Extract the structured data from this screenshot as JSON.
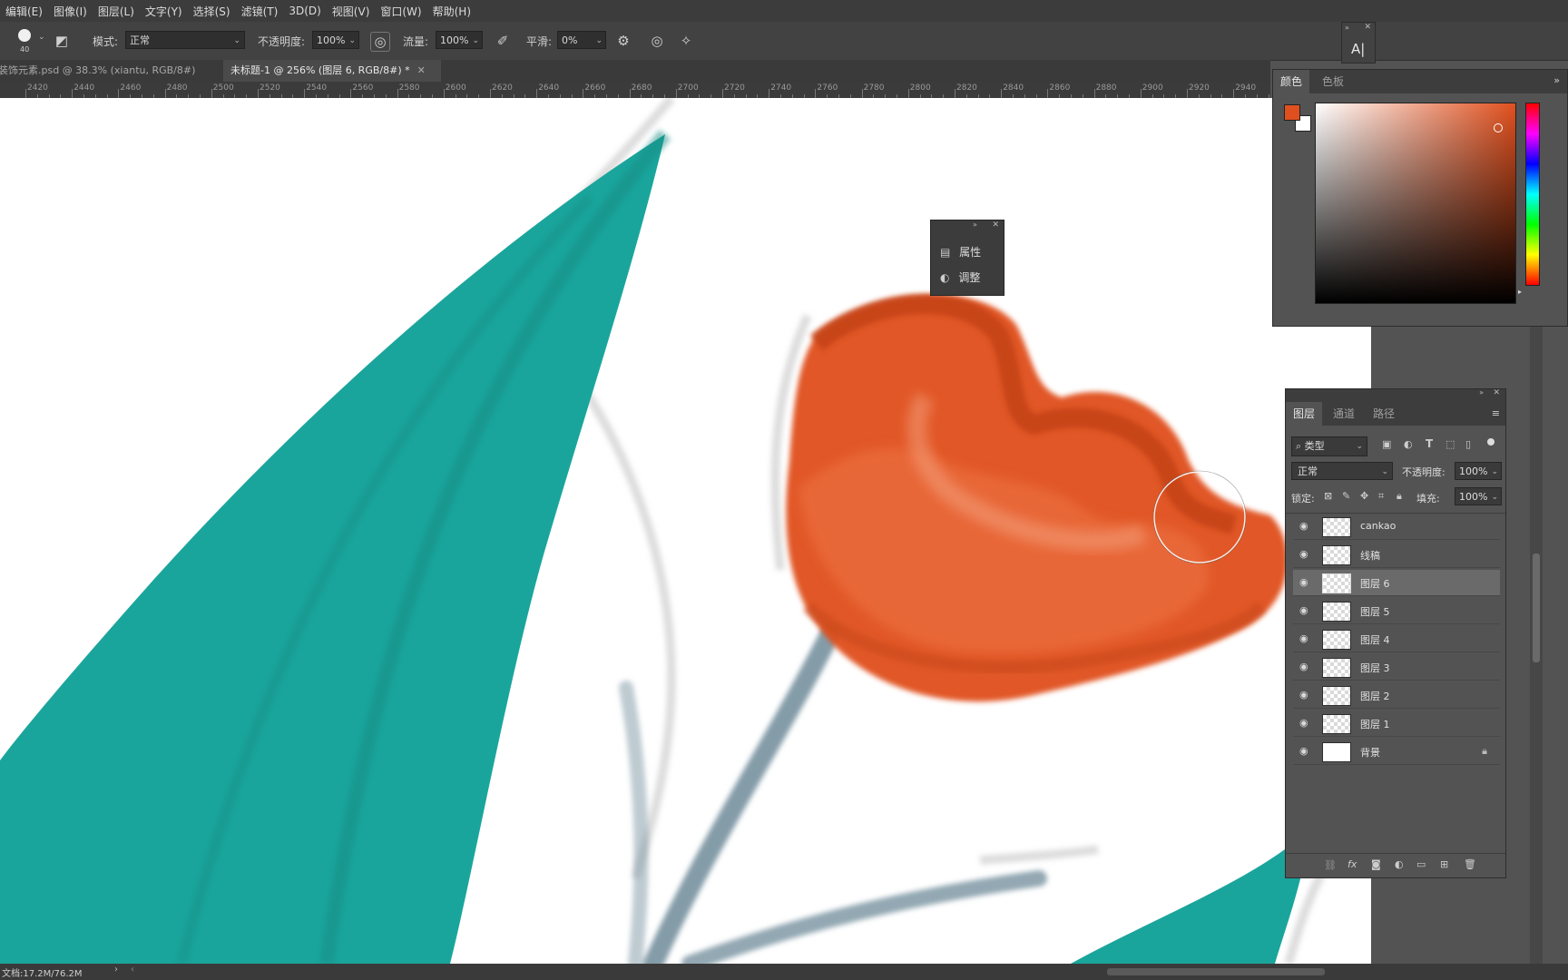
{
  "menu": [
    "编辑(E)",
    "图像(I)",
    "图层(L)",
    "文字(Y)",
    "选择(S)",
    "滤镜(T)",
    "3D(D)",
    "视图(V)",
    "窗口(W)",
    "帮助(H)"
  ],
  "options": {
    "brush_size": "40",
    "mode_label": "模式:",
    "mode_value": "正常",
    "opacity_label": "不透明度:",
    "opacity_value": "100%",
    "flow_label": "流量:",
    "flow_value": "100%",
    "smooth_label": "平滑:",
    "smooth_value": "0%"
  },
  "tabs": [
    {
      "label": "装饰元素.psd @ 38.3% (xiantu, RGB/8#) *",
      "active": false
    },
    {
      "label": "未标题-1 @ 256% (图层 6, RGB/8#) *",
      "active": true
    }
  ],
  "ruler_ticks": [
    "2420",
    "2440",
    "2460",
    "2480",
    "2500",
    "2520",
    "2540",
    "2560",
    "2580",
    "2600",
    "2620",
    "2640",
    "2660",
    "2680",
    "2700",
    "2720",
    "2740",
    "2760",
    "2780",
    "2800",
    "2820",
    "2840",
    "2860",
    "2880",
    "2900",
    "2920",
    "2940"
  ],
  "float_panel": {
    "items": [
      "属性",
      "调整"
    ]
  },
  "color_panel": {
    "tabs": [
      "颜色",
      "色板"
    ],
    "foreground": "#e0501e",
    "background": "#ffffff"
  },
  "layers_panel": {
    "tabs": [
      "图层",
      "通道",
      "路径"
    ],
    "filter_label": "类型",
    "blend_mode": "正常",
    "opacity_label": "不透明度:",
    "opacity_value": "100%",
    "lock_label": "锁定:",
    "fill_label": "填充:",
    "fill_value": "100%",
    "layers": [
      {
        "name": "cankao",
        "selected": false,
        "locked": false
      },
      {
        "name": "线稿",
        "selected": false,
        "locked": false
      },
      {
        "name": "图层 6",
        "selected": true,
        "locked": false
      },
      {
        "name": "图层 5",
        "selected": false,
        "locked": false
      },
      {
        "name": "图层 4",
        "selected": false,
        "locked": false
      },
      {
        "name": "图层 3",
        "selected": false,
        "locked": false
      },
      {
        "name": "图层 2",
        "selected": false,
        "locked": false
      },
      {
        "name": "图层 1",
        "selected": false,
        "locked": false
      },
      {
        "name": "背景",
        "selected": false,
        "locked": true
      }
    ]
  },
  "status": {
    "doc": "文档:17.2M/76.2M"
  },
  "colors": {
    "teal": "#1aa59c",
    "orange": "#e0501e",
    "stem": "#6f8b99"
  }
}
